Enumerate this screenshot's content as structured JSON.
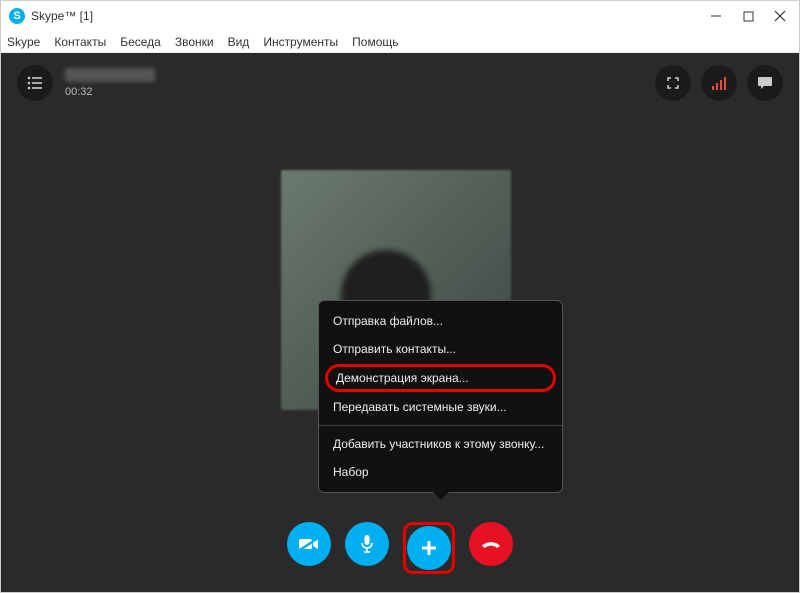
{
  "titlebar": {
    "title": "Skype™ [1]"
  },
  "menubar": {
    "items": [
      "Skype",
      "Контакты",
      "Беседа",
      "Звонки",
      "Вид",
      "Инструменты",
      "Помощь"
    ]
  },
  "call": {
    "timer": "00:32",
    "context_menu": {
      "send_files": "Отправка файлов...",
      "send_contacts": "Отправить контакты...",
      "share_screen": "Демонстрация экрана...",
      "system_sounds": "Передавать системные звуки...",
      "add_participants": "Добавить участников к этому звонку...",
      "dialpad": "Набор"
    }
  },
  "icons": {
    "skype_s": "S"
  }
}
